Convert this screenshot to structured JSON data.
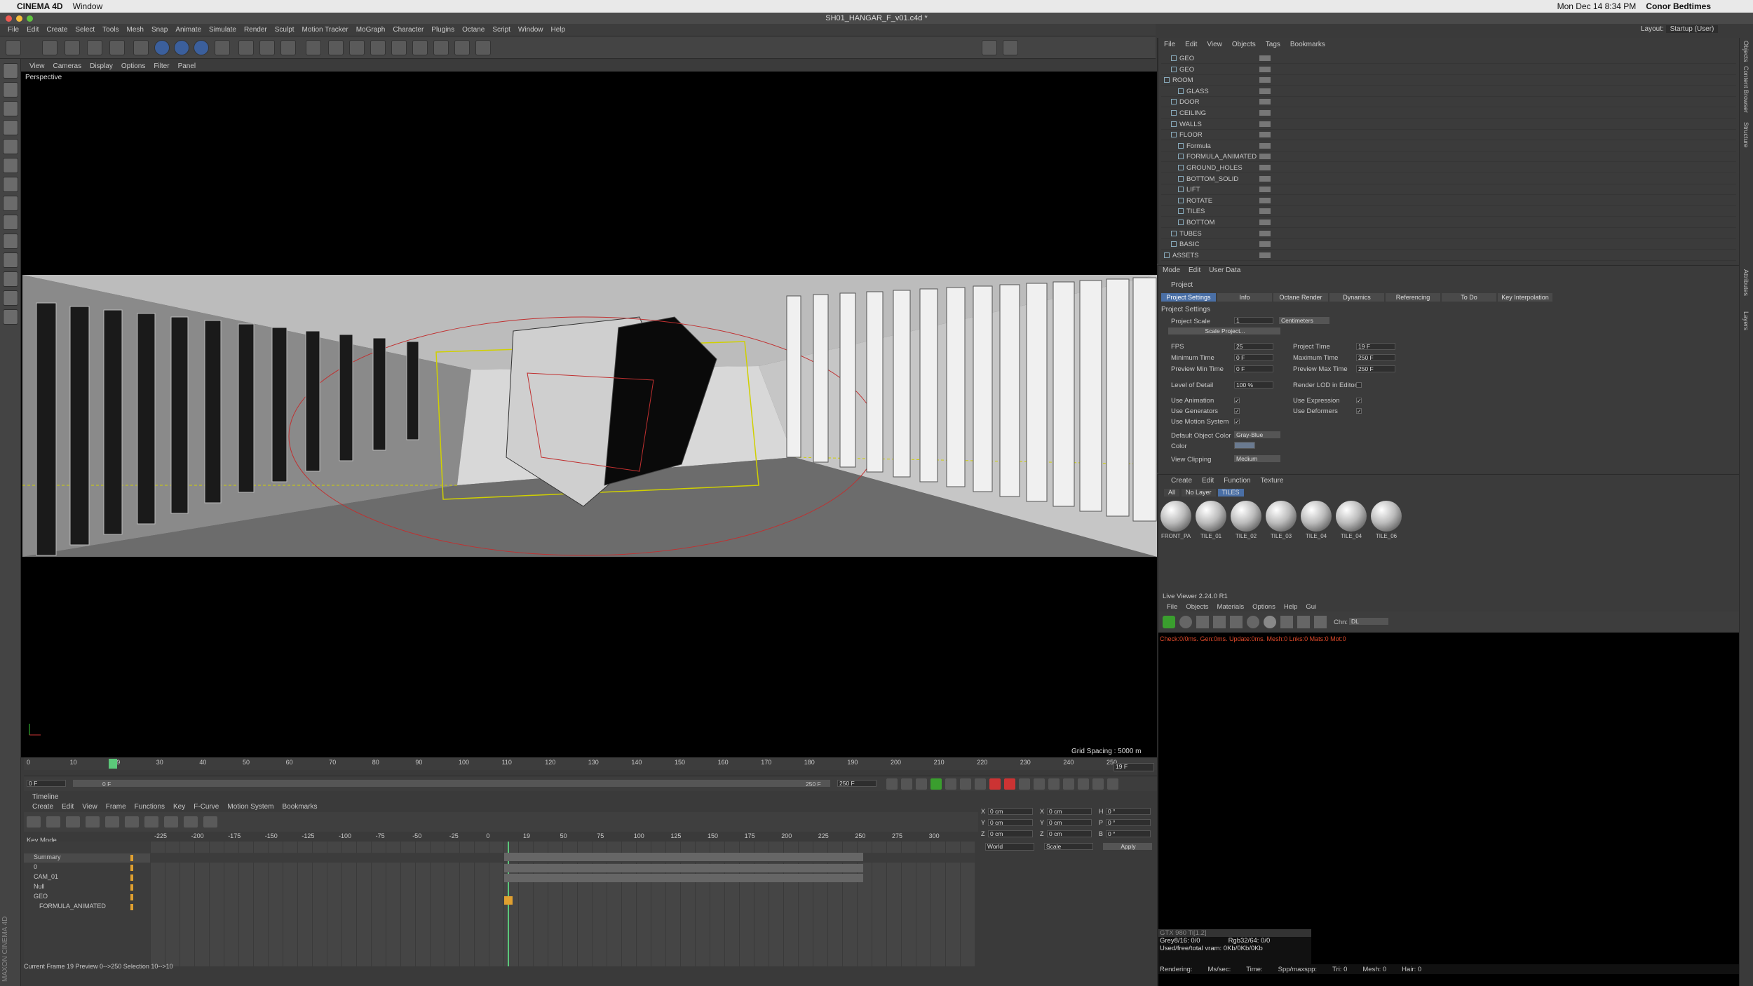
{
  "mac_menubar": {
    "app": "CINEMA 4D",
    "window_menu": "Window",
    "right_clock": "Mon Dec 14  8:34 PM",
    "user": "Conor Bedtimes"
  },
  "window_title": "SH01_HANGAR_F_v01.c4d *",
  "app_menu": [
    "File",
    "Edit",
    "Create",
    "Select",
    "Tools",
    "Mesh",
    "Snap",
    "Animate",
    "Simulate",
    "Render",
    "Sculpt",
    "Motion Tracker",
    "MoGraph",
    "Character",
    "Plugins",
    "Octane",
    "Script",
    "Window",
    "Help"
  ],
  "layout": {
    "label": "Layout:",
    "value": "Startup (User)"
  },
  "viewport": {
    "menu": [
      "View",
      "Cameras",
      "Display",
      "Options",
      "Filter",
      "Panel"
    ],
    "label": "Perspective",
    "grid_spacing": "Grid Spacing : 5000 m"
  },
  "timeline_ruler": {
    "ticks": [
      "0",
      "10",
      "19",
      "30",
      "40",
      "50",
      "60",
      "70",
      "80",
      "90",
      "100",
      "110",
      "120",
      "130",
      "140",
      "150",
      "160",
      "170",
      "180",
      "190",
      "200",
      "210",
      "220",
      "230",
      "240",
      "250"
    ],
    "current": "19 F",
    "start": "0 F",
    "range_left": "0 F",
    "range_right": "250 F",
    "end": "250 F"
  },
  "timeline": {
    "title": "Timeline",
    "menu": [
      "Create",
      "Edit",
      "View",
      "Frame",
      "Functions",
      "Key",
      "F-Curve",
      "Motion System",
      "Bookmarks"
    ],
    "mode": "Key Mode",
    "scale": [
      "-225",
      "-200",
      "-175",
      "-150",
      "-125",
      "-100",
      "-75",
      "-50",
      "-25",
      "0",
      "19",
      "50",
      "75",
      "100",
      "125",
      "150",
      "175",
      "200",
      "225",
      "250",
      "275",
      "300"
    ],
    "tracks": [
      "Summary",
      "0",
      "CAM_01",
      "Null",
      "GEO",
      "FORMULA_ANIMATED"
    ],
    "status": "Current Frame  19  Preview  0-->250   Selection  10-->10"
  },
  "coords": {
    "rows": [
      {
        "a": "X",
        "av": "0 cm",
        "b": "X",
        "bv": "0 cm",
        "c": "H",
        "cv": "0 °"
      },
      {
        "a": "Y",
        "av": "0 cm",
        "b": "Y",
        "bv": "0 cm",
        "c": "P",
        "cv": "0 °"
      },
      {
        "a": "Z",
        "av": "0 cm",
        "b": "Z",
        "bv": "0 cm",
        "c": "B",
        "cv": "0 °"
      }
    ],
    "world": "World",
    "scale": "Scale",
    "apply": "Apply"
  },
  "object_manager": {
    "menu": [
      "File",
      "Edit",
      "View",
      "Objects",
      "Tags",
      "Bookmarks"
    ],
    "objects": [
      {
        "name": "GEO",
        "indent": 1
      },
      {
        "name": "GEO",
        "indent": 1
      },
      {
        "name": "ROOM",
        "indent": 0
      },
      {
        "name": "GLASS",
        "indent": 2
      },
      {
        "name": "DOOR",
        "indent": 1
      },
      {
        "name": "CEILING",
        "indent": 1
      },
      {
        "name": "WALLS",
        "indent": 1
      },
      {
        "name": "FLOOR",
        "indent": 1
      },
      {
        "name": "Formula",
        "indent": 2
      },
      {
        "name": "FORMULA_ANIMATED",
        "indent": 2
      },
      {
        "name": "GROUND_HOLES",
        "indent": 2
      },
      {
        "name": "BOTTOM_SOLID",
        "indent": 2
      },
      {
        "name": "LIFT",
        "indent": 2
      },
      {
        "name": "ROTATE",
        "indent": 2
      },
      {
        "name": "TILES",
        "indent": 2
      },
      {
        "name": "BOTTOM",
        "indent": 2
      },
      {
        "name": "TUBES",
        "indent": 1
      },
      {
        "name": "BASIC",
        "indent": 1
      },
      {
        "name": "ASSETS",
        "indent": 0
      }
    ]
  },
  "attribute_manager": {
    "menu": [
      "Mode",
      "Edit",
      "User Data"
    ],
    "title": "Project",
    "tabs": [
      "Project Settings",
      "Info",
      "Octane Render",
      "Dynamics",
      "Referencing",
      "To Do",
      "Key Interpolation"
    ],
    "section": "Project Settings",
    "project_scale_label": "Project Scale",
    "project_scale_value": "1",
    "project_scale_unit": "Centimeters",
    "scale_project_btn": "Scale Project...",
    "fps_label": "FPS",
    "fps": "25",
    "project_time_label": "Project Time",
    "project_time": "19 F",
    "min_time_label": "Minimum Time",
    "min_time": "0 F",
    "max_time_label": "Maximum Time",
    "max_time": "250 F",
    "prev_min_label": "Preview Min Time",
    "prev_min": "0 F",
    "prev_max_label": "Preview Max Time",
    "prev_max": "250 F",
    "lod_label": "Level of Detail",
    "lod": "100 %",
    "render_lod_label": "Render LOD in Editor",
    "use_animation": "Use Animation",
    "use_expression": "Use Expression",
    "use_generators": "Use Generators",
    "use_deformers": "Use Deformers",
    "use_motion_system": "Use Motion System",
    "default_color_label": "Default Object Color",
    "default_color": "Gray-Blue",
    "color_label": "Color",
    "view_clipping_label": "View Clipping",
    "view_clipping": "Medium"
  },
  "material_manager": {
    "menu": [
      "Create",
      "Edit",
      "Function",
      "Texture"
    ],
    "filters": [
      "All",
      "No Layer",
      "TILES"
    ],
    "materials": [
      "FRONT_PA",
      "TILE_01",
      "TILE_02",
      "TILE_03",
      "TILE_04",
      "TILE_04",
      "TILE_06"
    ]
  },
  "live_viewer": {
    "title": "Live Viewer 2.24.0 R1",
    "menu": [
      "File",
      "Objects",
      "Materials",
      "Options",
      "Help",
      "Gui"
    ],
    "chn_label": "Chn:",
    "chn": "DL",
    "status": "Check:0/0ms. Gen:0ms. Update:0ms. Mesh:0 Lnks:0 Mats:0 Mot:0",
    "gpu": "GTX 980 Ti[1.2]",
    "grey": "Grey8/16: 0/0",
    "rgb": "Rgb32/64: 0/0",
    "vram": "Used/free/total vram: 0Kb/0Kb/0Kb",
    "render": [
      "Rendering:",
      "Ms/sec:",
      "Time:",
      "Spp/maxspp:",
      "Tri: 0",
      "Mesh: 0",
      "Hair: 0"
    ]
  },
  "right_tabs": [
    "Objects",
    "Content Browser",
    "Structure",
    "Attributes",
    "Layers"
  ],
  "maxon": "MAXON CINEMA 4D",
  "colors": {
    "accent": "#4a6fa5",
    "keyframe": "#e0a030",
    "error": "#e04a2b"
  }
}
